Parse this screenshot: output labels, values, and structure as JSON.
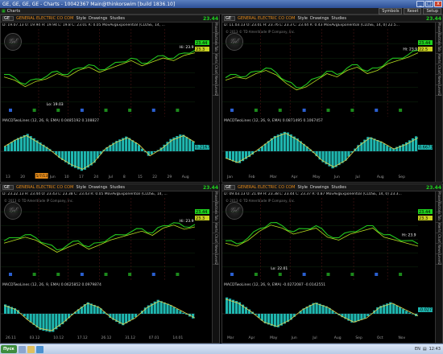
{
  "window": {
    "title": "GE, GE, GE, GE - Charts - 10042367 Main@thinkorswim [build 1836.10]",
    "min": "_",
    "max": "□",
    "close": "x"
  },
  "menubar": {
    "charts": "Charts"
  },
  "topright": {
    "symbols": "Symbols",
    "reset": "Reset",
    "setup": "Setup"
  },
  "panels": [
    {
      "symbol": "GE",
      "company": "GENERAL ELECTRIC CO COM",
      "style": "Style",
      "drawings": "Drawings",
      "studies": "Studies",
      "price": "23.44",
      "quote": "D: 19.07.13  O: 19.94  H: 19.94  L: 19.8  C: 23.01  R: 0.05  MovAvgExponential (CLOSE, 14, ...",
      "copyright": "",
      "logo": "ge",
      "hi_label": "Hi: 23.9",
      "lo_label": "Lo: 19.03",
      "macd": "MACDTwoLines (12, 26, 9, EMA)  0.0485192  0.108827",
      "macd_val": "0.2167",
      "price_tags": [
        "23.44",
        "23.3"
      ],
      "x_labels": [
        "13",
        "20",
        "27",
        "Jun",
        "10",
        "17",
        "24",
        "Jul",
        "8",
        "15",
        "22",
        "29",
        "Aug"
      ],
      "highlight_tag": "5/7/13"
    },
    {
      "symbol": "GE",
      "company": "GENERAL ELECTRIC CO COM",
      "style": "Style",
      "drawings": "Drawings",
      "studies": "Studies",
      "price": "23.44",
      "quote": "D: 11.03.13  O: 23.01  H: 23.76  L: 23.3  C: 23.44  R: 0.43  MovAvgExponential (CLOSE, 14, 0)  22.5...",
      "copyright": "© 2013 © TD Ameritrade IP Company, Inc.",
      "logo": "ge",
      "hi_label": "Hi: 23.9",
      "lo_label": "",
      "macd": "MACDTwoLines (12, 26, 9, EMA)  0.0871495  0.1067457",
      "macd_val": "0.6673",
      "price_tags": [
        "23.44",
        "22.5"
      ],
      "x_labels": [
        "Jan",
        "Feb",
        "Mar",
        "Apr",
        "May",
        "Jun",
        "Jul",
        "Aug",
        "Sep"
      ],
      "highlight_tag": ""
    },
    {
      "symbol": "GE",
      "company": "GENERAL ELECTRIC CO COM",
      "style": "Style",
      "drawings": "Drawings",
      "studies": "Studies",
      "price": "23.44",
      "quote": "D: 23.22.13  H: 23.44  O: 23.43  L: 23.38  C: 23.43  R: 0.05  MovAvgExponential (CLOSE, 14, ...",
      "copyright": "© 2013 © TD Ameritrade IP Company, Inc.",
      "logo": "ge",
      "hi_label": "Hi: 23.9",
      "lo_label": "",
      "macd": "MACDTwoLines (12, 26, 9, EMA)  0.0625852  0.0979874",
      "macd_val": "",
      "price_tags": [
        "23.44",
        "23.3"
      ],
      "x_labels": [
        "26.11",
        "03.12",
        "10.12",
        "17.12",
        "26.12",
        "31.12",
        "07.01",
        "14.01"
      ],
      "highlight_tag": ""
    },
    {
      "symbol": "GE",
      "company": "GENERAL ELECTRIC CO COM",
      "style": "Style",
      "drawings": "Drawings",
      "studies": "Studies",
      "price": "23.44",
      "quote": "D: 09.03.13  O: 21.69  H: 23.38  L: 23.44  C: 23.37  R: 0.87  MovAvgExponential (CLOSE, 14, 0)  23.3...",
      "copyright": "© 2013 © TD Ameritrade IP Company, Inc.",
      "logo": "ge",
      "hi_label": "Hi: 23.9",
      "lo_label": "Lo: 22.01",
      "macd": "MACDTwoLines (12, 26, 9, EMA)  -0.0272087  -0.0142551",
      "macd_val": "-0.0272",
      "price_tags": [
        "23.44",
        "23.3"
      ],
      "x_labels": [
        "Mar",
        "Apr",
        "May",
        "Jun",
        "Jul",
        "Aug",
        "Sep",
        "Oct",
        "Nov"
      ],
      "highlight_tag": ""
    }
  ],
  "sidetabs": [
    "Phase",
    "Buttons",
    "Tab",
    "Alerts",
    "Chart",
    "News",
    "Level2",
    "Zoom",
    "Info"
  ],
  "taskbar": {
    "start": "Пуск",
    "lang": "EN",
    "time": "12:43"
  },
  "colors": {
    "price_line": "#22c71f",
    "price_line_2": "#b8e020",
    "ema": "#f0c020",
    "macd_hist": "#1fb7b0",
    "macd_signal": "#e8d14a",
    "grid": "#1a3a1a",
    "accent": "#1fd11f"
  }
}
